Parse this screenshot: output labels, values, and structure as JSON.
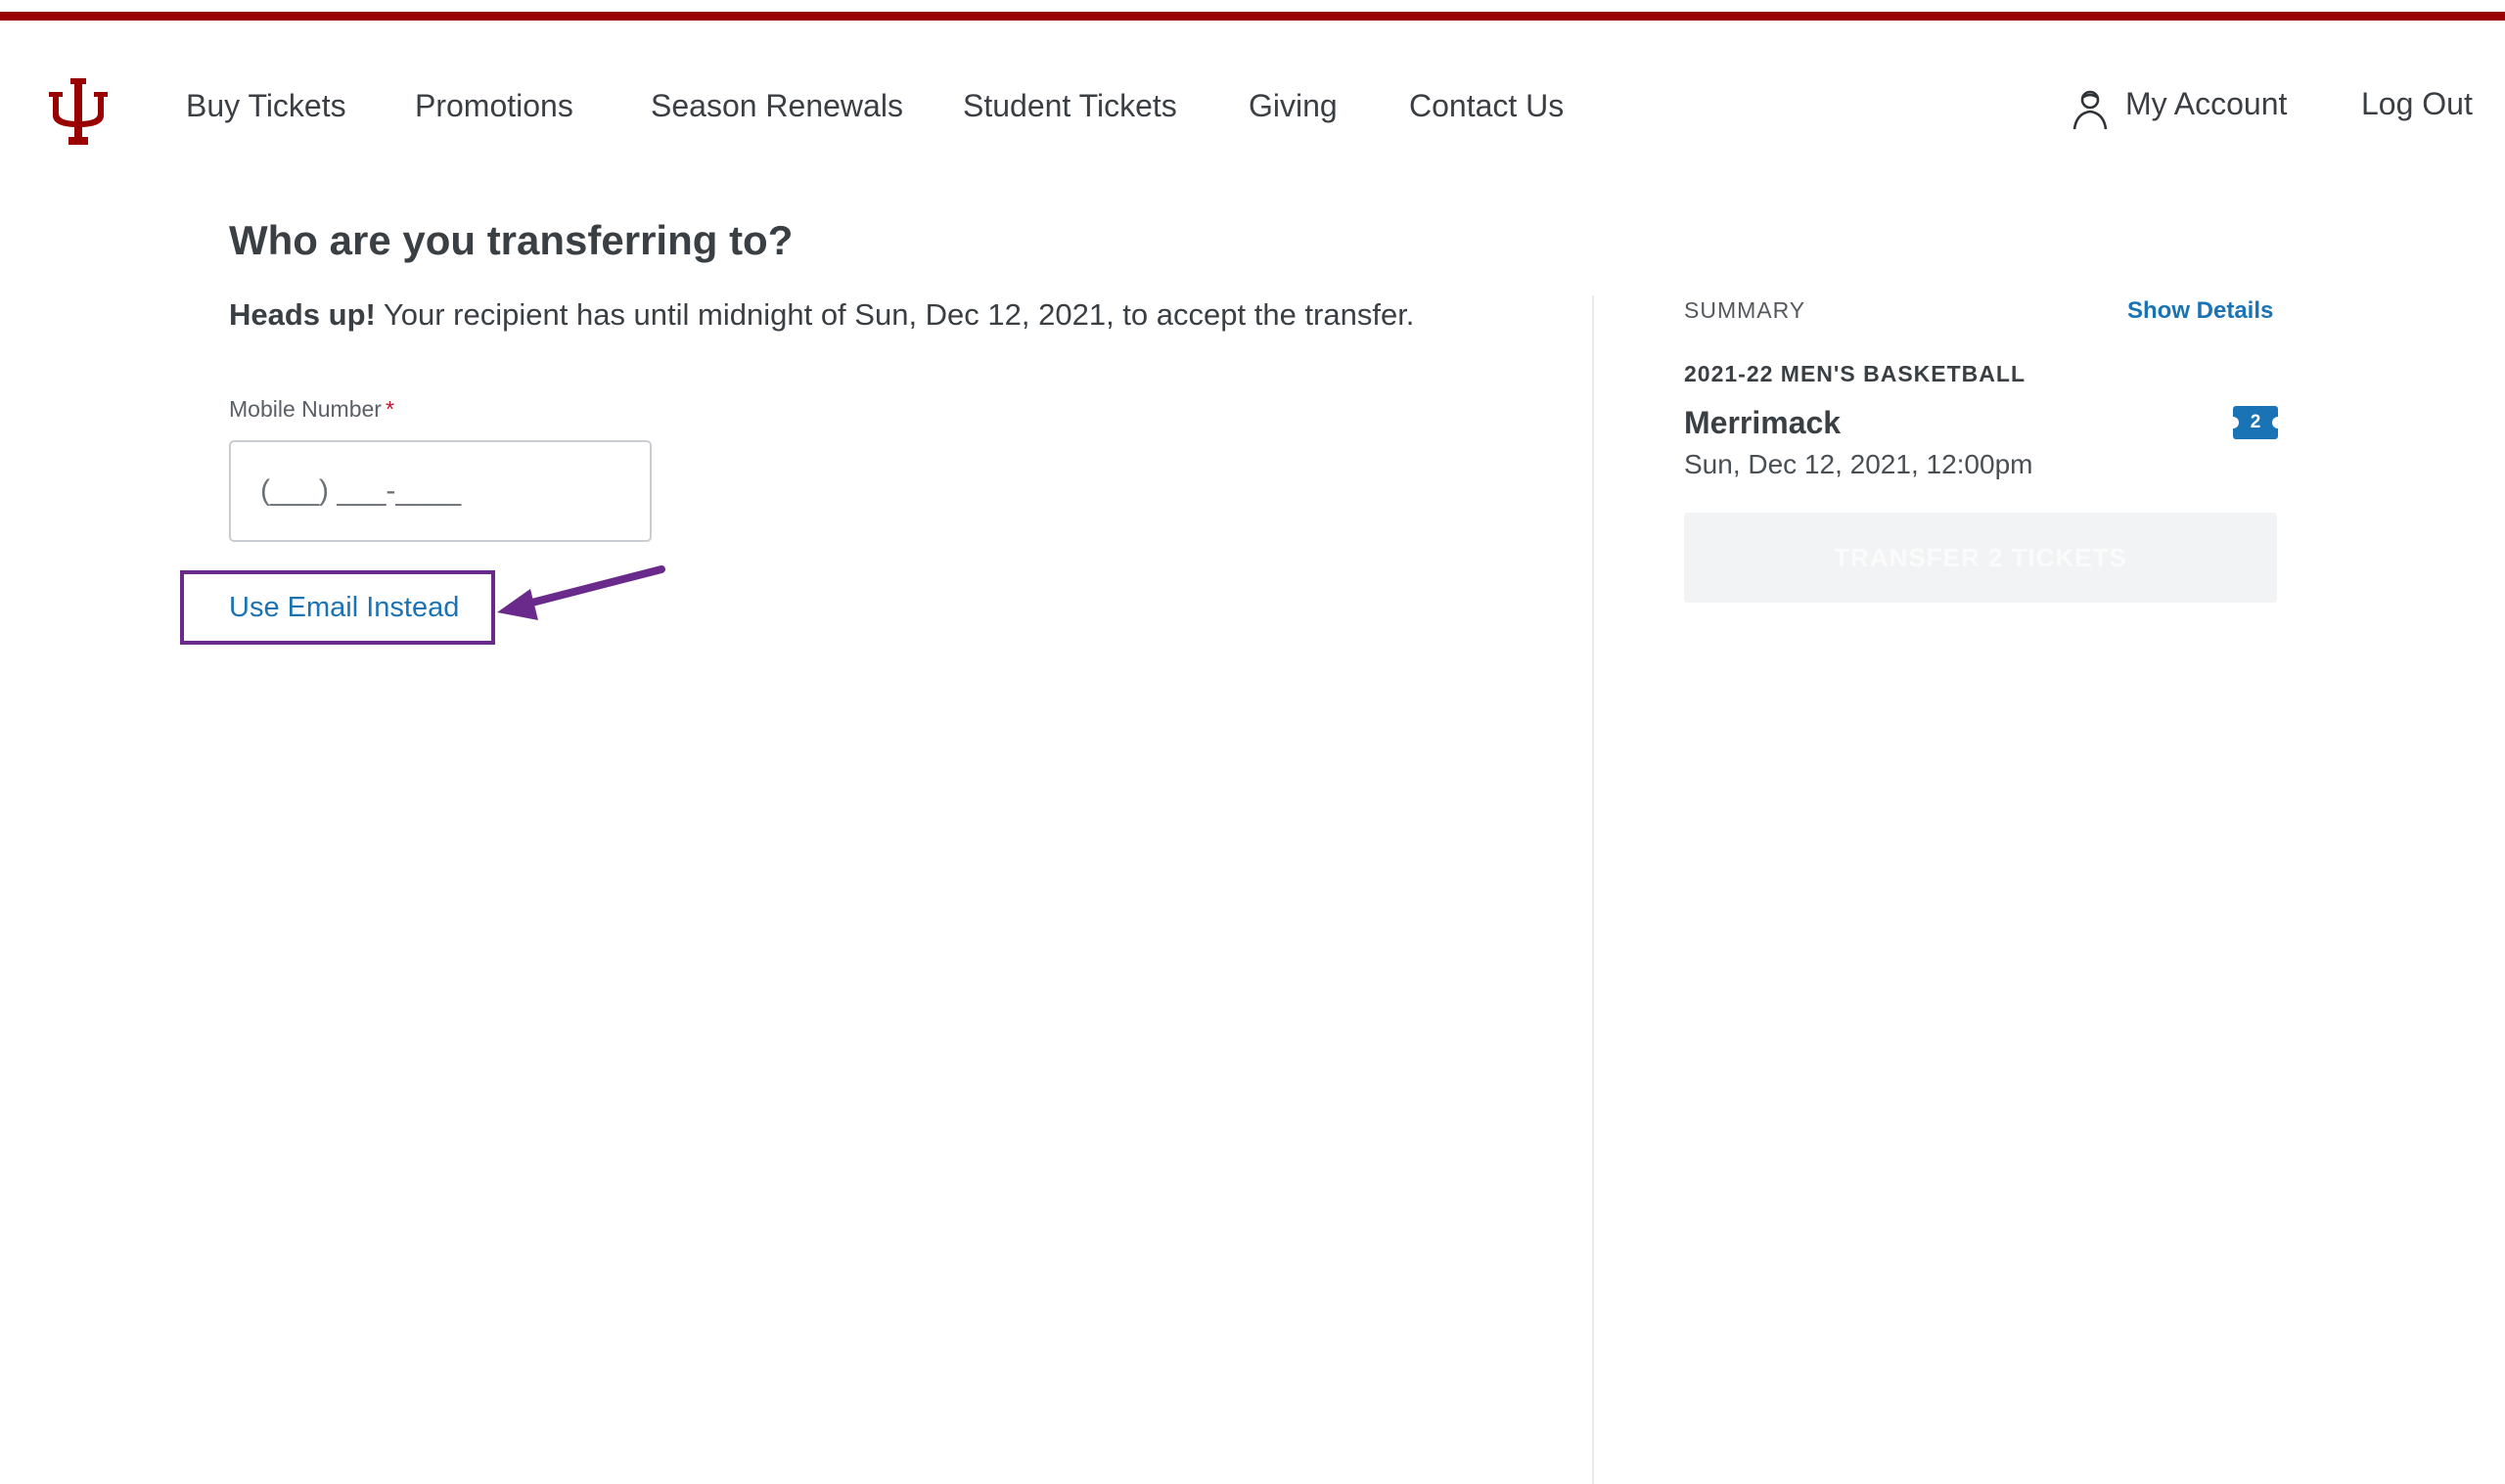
{
  "colors": {
    "brand": "#990000",
    "link": "#1a73b5",
    "annotation": "#6a2a8c",
    "required": "#c8102e"
  },
  "nav": {
    "items": [
      {
        "label": "Buy Tickets"
      },
      {
        "label": "Promotions"
      },
      {
        "label": "Season Renewals"
      },
      {
        "label": "Student Tickets"
      },
      {
        "label": "Giving"
      },
      {
        "label": "Contact Us"
      }
    ],
    "account_label": "My Account",
    "logout_label": "Log Out"
  },
  "transfer": {
    "title": "Who are you transferring to?",
    "headsup_bold": "Heads up!",
    "headsup_text": "Your recipient has until midnight of Sun, Dec 12, 2021, to accept the transfer.",
    "mobile_label": "Mobile Number",
    "required_marker": "*",
    "mobile_placeholder": "(___) ___-____",
    "use_email_label": "Use Email Instead"
  },
  "summary": {
    "label": "SUMMARY",
    "show_details": "Show Details",
    "season": "2021-22 MEN'S BASKETBALL",
    "event_name": "Merrimack",
    "event_date": "Sun, Dec 12, 2021, 12:00pm",
    "ticket_count": "2",
    "transfer_button": "TRANSFER 2 TICKETS"
  }
}
